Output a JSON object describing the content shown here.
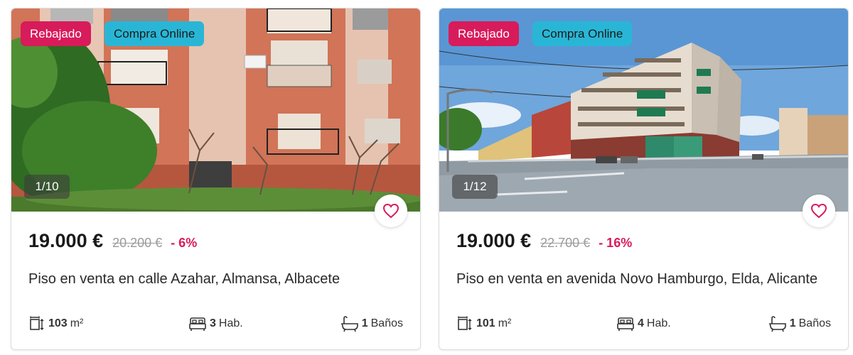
{
  "colors": {
    "sale_badge": "#d81b5a",
    "online_badge": "#29b6d6",
    "discount": "#d81b5a",
    "heart": "#d81b5a"
  },
  "listings": [
    {
      "badges": {
        "sale": "Rebajado",
        "online": "Compra Online"
      },
      "photo_counter": "1/10",
      "price": "19.000 €",
      "old_price": "20.200 €",
      "discount": "- 6%",
      "title": "Piso en venta en calle Azahar, Almansa, Albacete",
      "features": {
        "area_value": "103",
        "area_unit": "m²",
        "rooms_value": "3",
        "rooms_label": "Hab.",
        "baths_value": "1",
        "baths_label": "Baños"
      },
      "icons": [
        "area-icon",
        "bed-icon",
        "bath-icon",
        "heart-icon"
      ]
    },
    {
      "badges": {
        "sale": "Rebajado",
        "online": "Compra Online"
      },
      "photo_counter": "1/12",
      "price": "19.000 €",
      "old_price": "22.700 €",
      "discount": "- 16%",
      "title": "Piso en venta en avenida Novo Hamburgo, Elda, Alicante",
      "features": {
        "area_value": "101",
        "area_unit": "m²",
        "rooms_value": "4",
        "rooms_label": "Hab.",
        "baths_value": "1",
        "baths_label": "Baños"
      },
      "icons": [
        "area-icon",
        "bed-icon",
        "bath-icon",
        "heart-icon"
      ]
    }
  ]
}
